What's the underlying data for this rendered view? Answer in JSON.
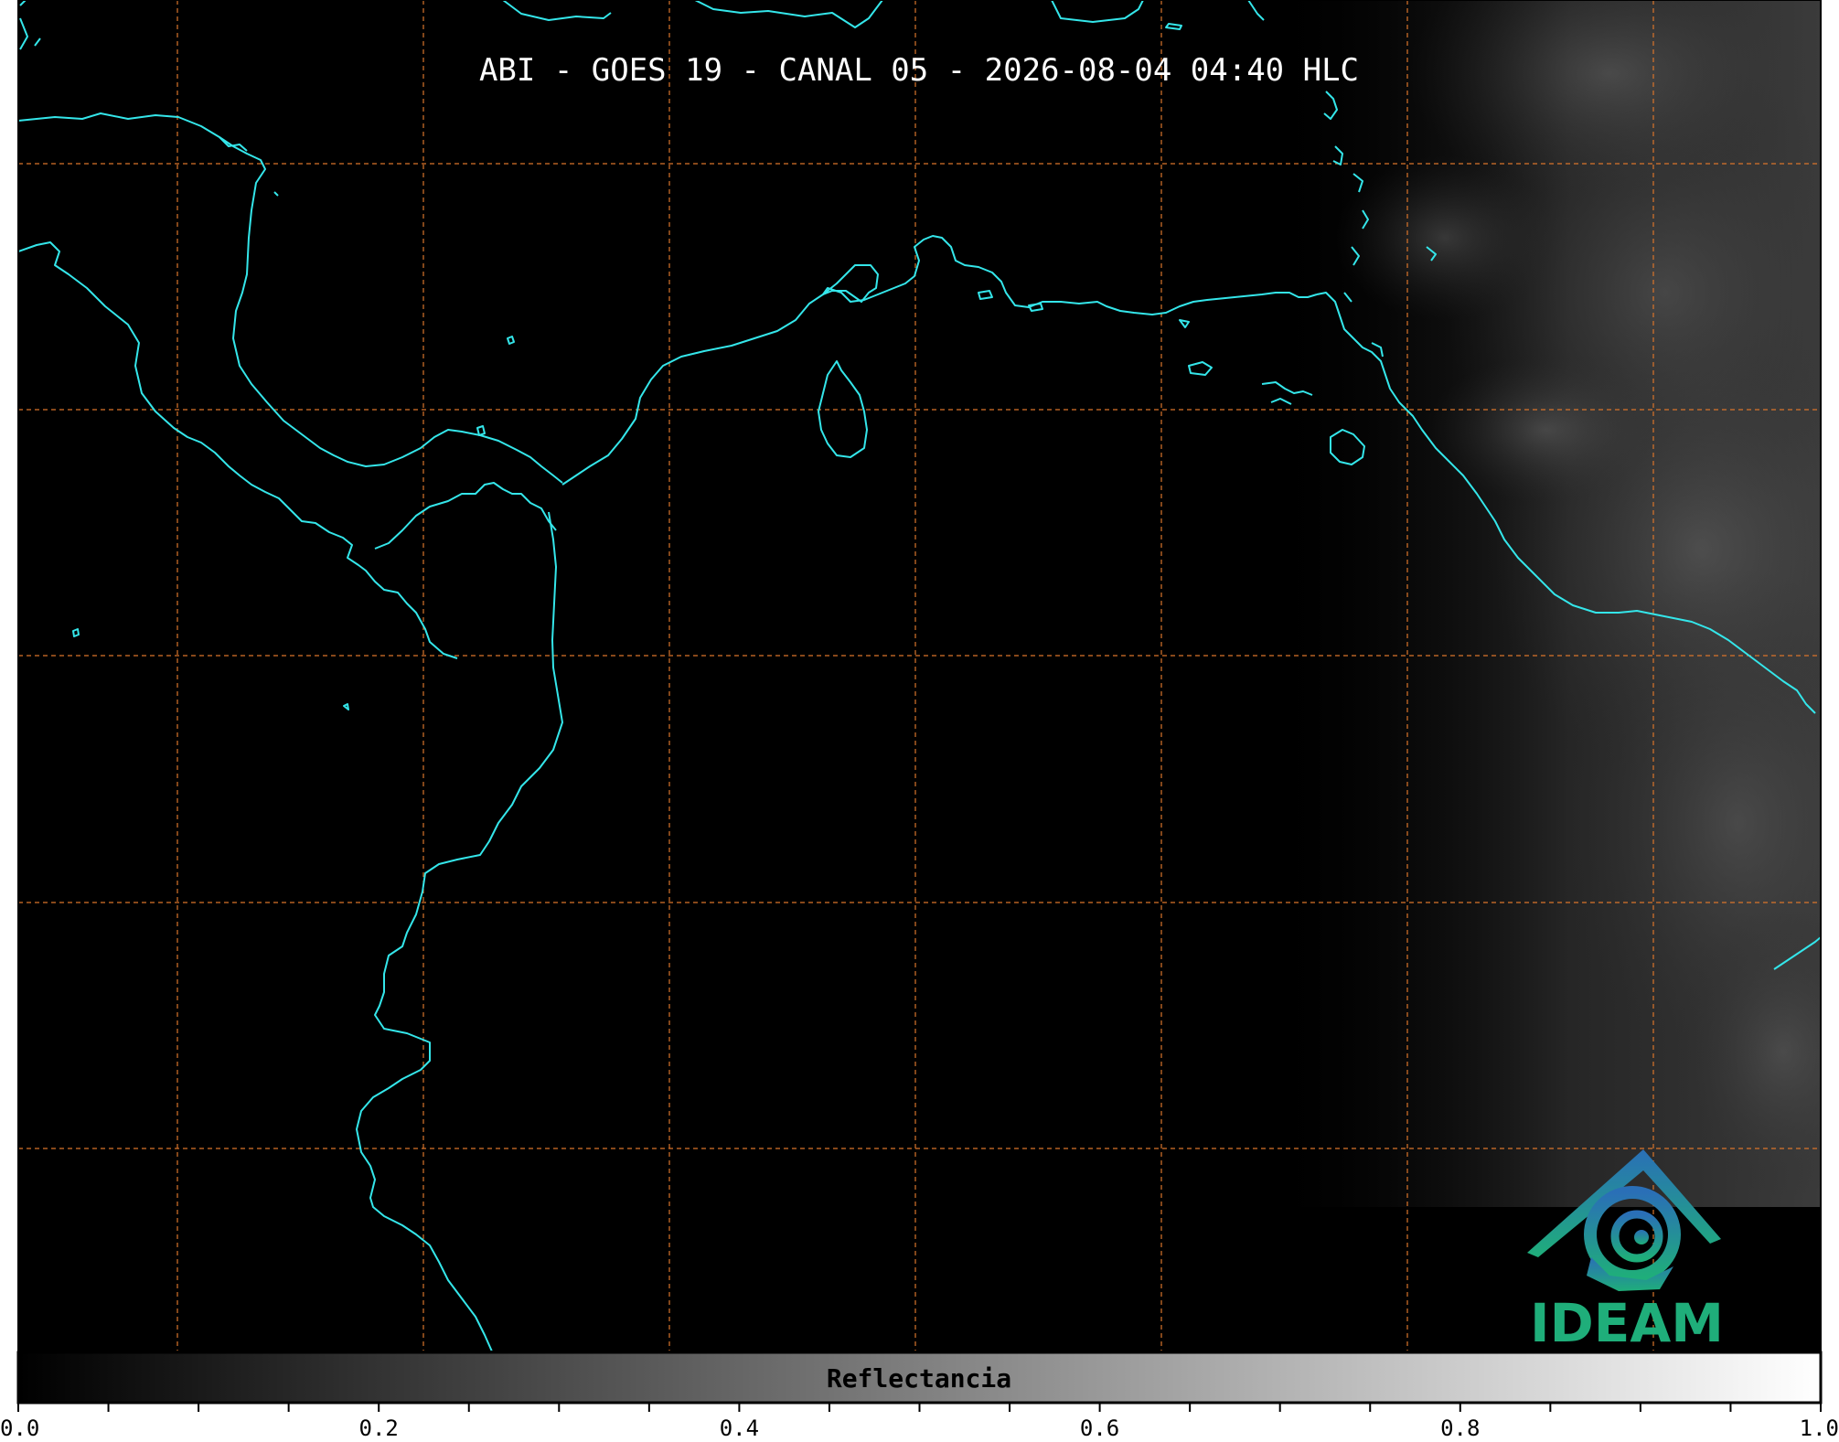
{
  "map": {
    "title": "ABI - GOES 19 - CANAL 05 - 2026-08-04 04:40 HLC",
    "background_color": "#000000",
    "coastline_color": "#34e6ea",
    "gridline_color": "#d9742b",
    "gridlines": "dashed",
    "cloud_region": "east"
  },
  "colorbar": {
    "label": "Reflectancia",
    "colormap": "grayscale",
    "min": 0.0,
    "max": 1.0,
    "tick_labels": [
      "0.0",
      "0.2",
      "0.4",
      "0.6",
      "0.8",
      "1.0"
    ],
    "tick_values": [
      0.0,
      0.2,
      0.4,
      0.6,
      0.8,
      1.0
    ],
    "minor_tick_step": 0.05
  },
  "logo": {
    "text": "IDEAM",
    "icon": "ideam-logo-icon",
    "color_top": "#2a6fb7",
    "color_bottom": "#1fae7a"
  }
}
